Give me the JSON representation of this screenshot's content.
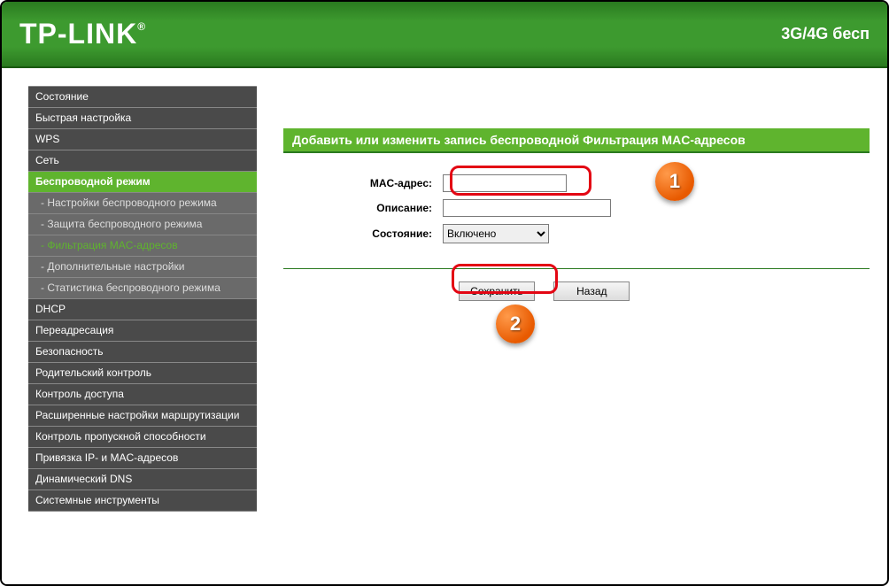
{
  "header": {
    "logo": "TP-LINK",
    "right_text": "3G/4G бесп"
  },
  "sidebar": {
    "items": [
      {
        "label": "Состояние",
        "type": "top"
      },
      {
        "label": "Быстрая настройка",
        "type": "top"
      },
      {
        "label": "WPS",
        "type": "top"
      },
      {
        "label": "Сеть",
        "type": "top"
      },
      {
        "label": "Беспроводной режим",
        "type": "active"
      },
      {
        "label": "- Настройки беспроводного режима",
        "type": "sub"
      },
      {
        "label": "- Защита беспроводного режима",
        "type": "sub"
      },
      {
        "label": "- Фильтрация MAC-адресов",
        "type": "sub-active"
      },
      {
        "label": "- Дополнительные настройки",
        "type": "sub"
      },
      {
        "label": "- Статистика беспроводного режима",
        "type": "sub"
      },
      {
        "label": "DHCP",
        "type": "top"
      },
      {
        "label": "Переадресация",
        "type": "top"
      },
      {
        "label": "Безопасность",
        "type": "top"
      },
      {
        "label": "Родительский контроль",
        "type": "top"
      },
      {
        "label": "Контроль доступа",
        "type": "top"
      },
      {
        "label": "Расширенные настройки маршрутизации",
        "type": "top"
      },
      {
        "label": "Контроль пропускной способности",
        "type": "top"
      },
      {
        "label": "Привязка IP- и MAC-адресов",
        "type": "top"
      },
      {
        "label": "Динамический DNS",
        "type": "top"
      },
      {
        "label": "Системные инструменты",
        "type": "top"
      }
    ]
  },
  "page": {
    "title": "Добавить или изменить запись беспроводной Фильтрация MAC-адресов",
    "fields": {
      "mac_label": "MAC-адрес:",
      "mac_value": "",
      "desc_label": "Описание:",
      "desc_value": "",
      "state_label": "Состояние:",
      "state_value": "Включено"
    },
    "buttons": {
      "save": "Сохранить",
      "back": "Назад"
    }
  },
  "annotations": {
    "badge1": "1",
    "badge2": "2"
  }
}
